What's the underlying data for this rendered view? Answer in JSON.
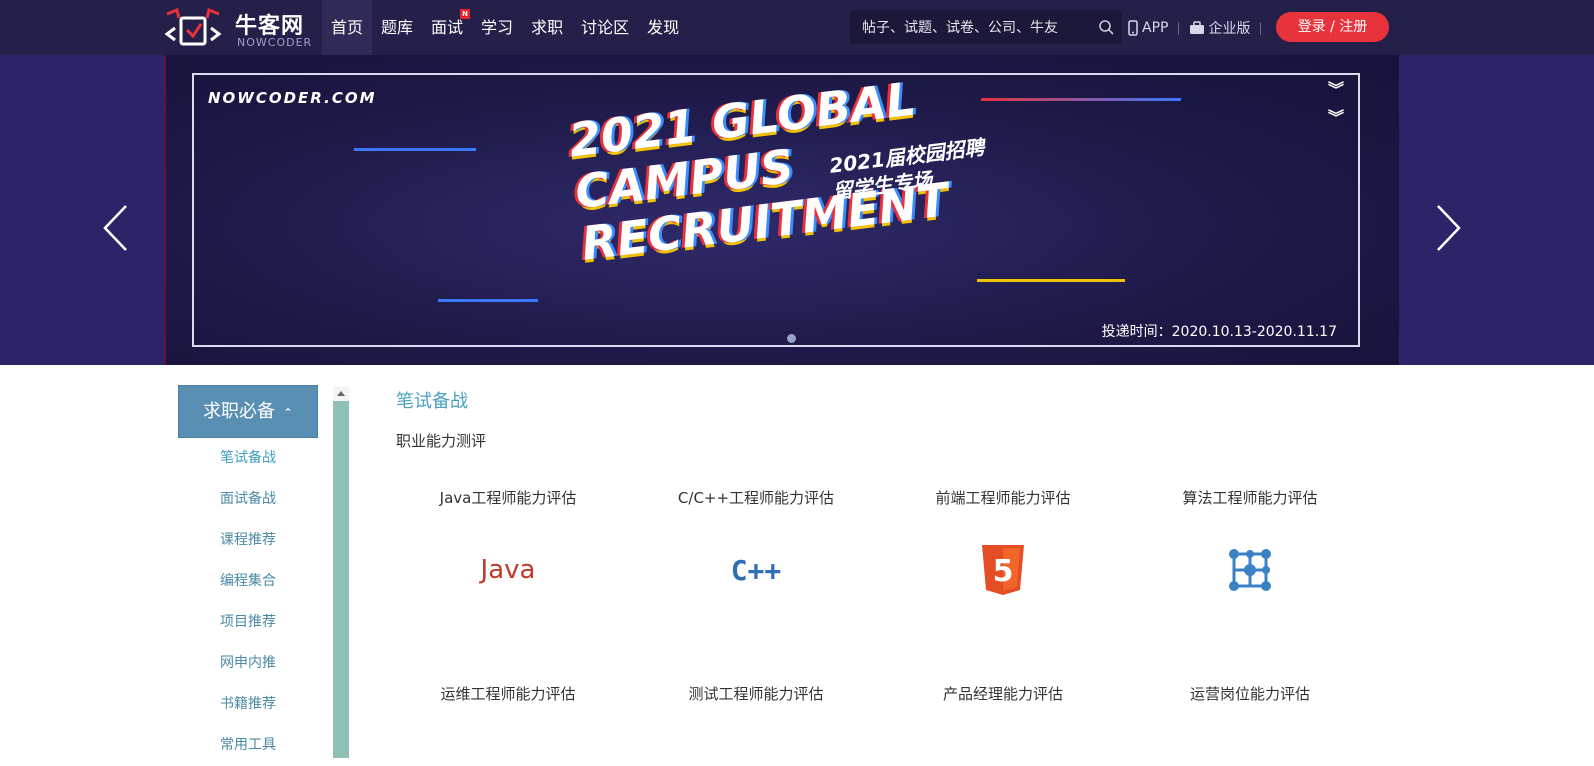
{
  "header": {
    "logo_text": "牛客网",
    "logo_sub": "NOWCODER",
    "nav": [
      {
        "label": "首页",
        "active": true
      },
      {
        "label": "题库"
      },
      {
        "label": "面试",
        "badge": "N"
      },
      {
        "label": "学习"
      },
      {
        "label": "求职"
      },
      {
        "label": "讨论区"
      },
      {
        "label": "发现"
      }
    ],
    "search_placeholder": "帖子、试题、试卷、公司、牛友",
    "app_label": "APP",
    "enterprise_label": "企业版",
    "login_label": "登录 / 注册"
  },
  "banner": {
    "site": "NOWCODER.COM",
    "title_lines": [
      "2021 GLOBAL",
      "CAMPUS",
      "RECRUITMENT"
    ],
    "cn_lines": [
      "2021届校园招聘",
      "留学生专场"
    ],
    "date": "投递时间：2020.10.13-2020.11.17"
  },
  "sidebar": {
    "heading": "求职必备",
    "items": [
      "笔试备战",
      "面试备战",
      "课程推荐",
      "编程集合",
      "项目推荐",
      "网申内推",
      "书籍推荐",
      "常用工具"
    ]
  },
  "main": {
    "section_title": "笔试备战",
    "subsection_title": "职业能力测评",
    "cards": [
      {
        "label": "Java工程师能力评估",
        "icon": "java-logo-icon",
        "icon_text": "Java"
      },
      {
        "label": "C/C++工程师能力评估",
        "icon": "cpp-logo-icon",
        "icon_text": "C++"
      },
      {
        "label": "前端工程师能力评估",
        "icon": "html5-icon",
        "icon_text": "5"
      },
      {
        "label": "算法工程师能力评估",
        "icon": "algorithm-icon"
      },
      {
        "label": "运维工程师能力评估"
      },
      {
        "label": "测试工程师能力评估"
      },
      {
        "label": "产品经理能力评估"
      },
      {
        "label": "运营岗位能力评估"
      }
    ]
  },
  "colors": {
    "topbar": "#25204a",
    "login_button": "#e8323c",
    "sidebar_head": "#5a8fb4",
    "accent_text": "#4aa0c0"
  }
}
